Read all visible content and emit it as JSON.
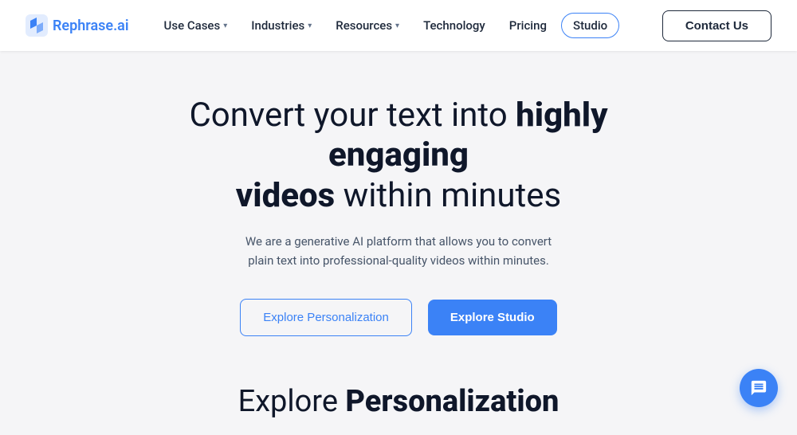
{
  "navbar": {
    "logo_text": "Rephrase.ai",
    "nav_items": [
      {
        "label": "Use Cases",
        "has_dropdown": true
      },
      {
        "label": "Industries",
        "has_dropdown": true
      },
      {
        "label": "Resources",
        "has_dropdown": true
      },
      {
        "label": "Technology",
        "has_dropdown": false
      },
      {
        "label": "Pricing",
        "has_dropdown": false
      },
      {
        "label": "Studio",
        "has_dropdown": false,
        "style": "studio"
      }
    ],
    "contact_label": "Contact Us"
  },
  "hero": {
    "title_part1": "Convert your text into ",
    "title_part2": "highly engaging videos",
    "title_part3": " within minutes",
    "subtitle": "We are a generative AI platform that allows you to convert plain text into professional-quality videos within minutes.",
    "btn_outline_label": "Explore Personalization",
    "btn_primary_label": "Explore Studio"
  },
  "explore_section": {
    "title_normal": "Explore ",
    "title_bold": "Personalization"
  }
}
